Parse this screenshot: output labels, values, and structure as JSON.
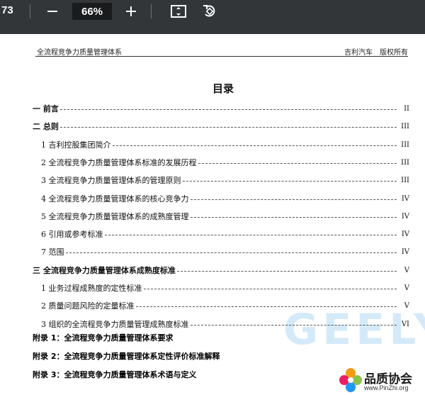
{
  "toolbar": {
    "page_indicator": "73",
    "zoom_value": "66%",
    "icons": [
      "minus-icon",
      "plus-icon",
      "fit-page-icon",
      "rotate-icon"
    ]
  },
  "page": {
    "header_left": "全流程竞争力质量管理体系",
    "header_right_company": "吉利汽车",
    "header_right_rights": "版权所有",
    "toc_title": "目录",
    "toc": [
      {
        "label": "一  前言",
        "page": "II",
        "level": 1
      },
      {
        "label": "二  总则",
        "page": "III",
        "level": 1
      },
      {
        "label": "1  吉利控股集团简介",
        "page": "III",
        "level": 2
      },
      {
        "label": "2  全流程竞争力质量管理体系标准的发展历程",
        "page": "III",
        "level": 2
      },
      {
        "label": "3  全流程竞争力质量管理体系的管理原则",
        "page": "III",
        "level": 2
      },
      {
        "label": "4  全流程竞争力质量管理体系的核心竞争力",
        "page": "IV",
        "level": 2
      },
      {
        "label": "5  全流程竞争力质量管理体系的成熟度管理",
        "page": "IV",
        "level": 2
      },
      {
        "label": "6  引用或参考标准",
        "page": "IV",
        "level": 2
      },
      {
        "label": "7  范围",
        "page": "IV",
        "level": 2
      },
      {
        "label": "三  全流程竞争力质量管理体系成熟度标准",
        "page": "V",
        "level": 1
      },
      {
        "label": "1  业务过程成熟度的定性标准",
        "page": "V",
        "level": 2
      },
      {
        "label": "2  质量问题风险的定量标准",
        "page": "V",
        "level": 2
      },
      {
        "label": "3  组织的全流程竞争力质量管理成熟度标准",
        "page": "VI",
        "level": 2
      }
    ],
    "appendices": [
      "附录 1：全流程竞争力质量管理体系要求",
      "附录 2：全流程竞争力质量管理体系定性评价标准解释",
      "附录 3：全流程竞争力质量管理体系术语与定义"
    ],
    "watermark": "GEELY",
    "logo_name": "品质协会",
    "logo_url": "www.PinZhi.org"
  },
  "colors": {
    "toolbar_bg": "#323639",
    "zoom_box_bg": "#191b1c",
    "watermark": "#c8e3f7"
  }
}
